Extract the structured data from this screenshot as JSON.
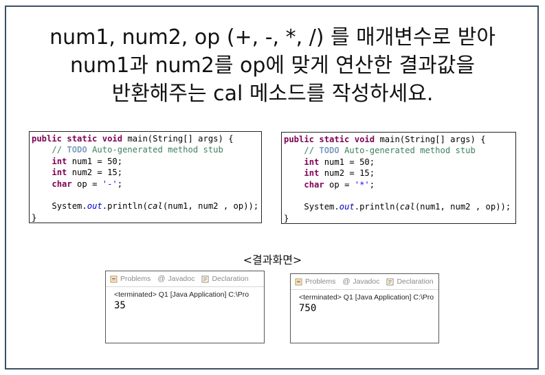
{
  "heading": {
    "line1": "num1, num2, op (+, -, *, /) 를 매개변수로 받아",
    "line2": "num1과 num2를 op에 맞게 연산한 결과값을",
    "line3": "반환해주는 cal 메소드를 작성하세요."
  },
  "code_samples": [
    {
      "op_value": "'-'",
      "lines": {
        "sig_public": "public",
        "sig_static": "static",
        "sig_void": "void",
        "sig_rest": " main(String[] args) {",
        "comment_prefix": "// ",
        "comment_todo": "TODO",
        "comment_rest": " Auto-generated method stub",
        "kw_int": "int",
        "num1_decl": " num1 = 50;",
        "num2_decl": " num2 = 15;",
        "kw_char": "char",
        "op_decl": " op = ",
        "print_prefix": "System.",
        "print_out": "out",
        "print_mid": ".println(",
        "print_cal": "cal",
        "print_args": "(num1, num2 , op));",
        "close": "}"
      }
    },
    {
      "op_value": "'*'",
      "lines": {
        "sig_public": "public",
        "sig_static": "static",
        "sig_void": "void",
        "sig_rest": " main(String[] args) {",
        "comment_prefix": "// ",
        "comment_todo": "TODO",
        "comment_rest": " Auto-generated method stub",
        "kw_int": "int",
        "num1_decl": " num1 = 50;",
        "num2_decl": " num2 = 15;",
        "kw_char": "char",
        "op_decl": " op = ",
        "print_prefix": "System.",
        "print_out": "out",
        "print_mid": ".println(",
        "print_cal": "cal",
        "print_args": "(num1, num2 , op));",
        "close": "}"
      }
    }
  ],
  "result_label": "<결과화면>",
  "consoles": [
    {
      "tabs": {
        "problems": "Problems",
        "javadoc": "Javadoc",
        "declaration": "Declaration"
      },
      "status": "<terminated> Q1 [Java Application] C:\\Pro",
      "output": "35"
    },
    {
      "tabs": {
        "problems": "Problems",
        "javadoc": "Javadoc",
        "declaration": "Declaration"
      },
      "status": "<terminated> Q1 [Java Application] C:\\Pro",
      "output": "750"
    }
  ],
  "icons": {
    "problems": "problems-icon",
    "javadoc": "at-sign-icon",
    "declaration": "declaration-icon"
  },
  "colors": {
    "keyword": "#7f0055",
    "comment": "#3f7f5f",
    "todo": "#7f9fbf",
    "string": "#2a00ff",
    "field": "#0000c0",
    "frame": "#3b4e63"
  }
}
